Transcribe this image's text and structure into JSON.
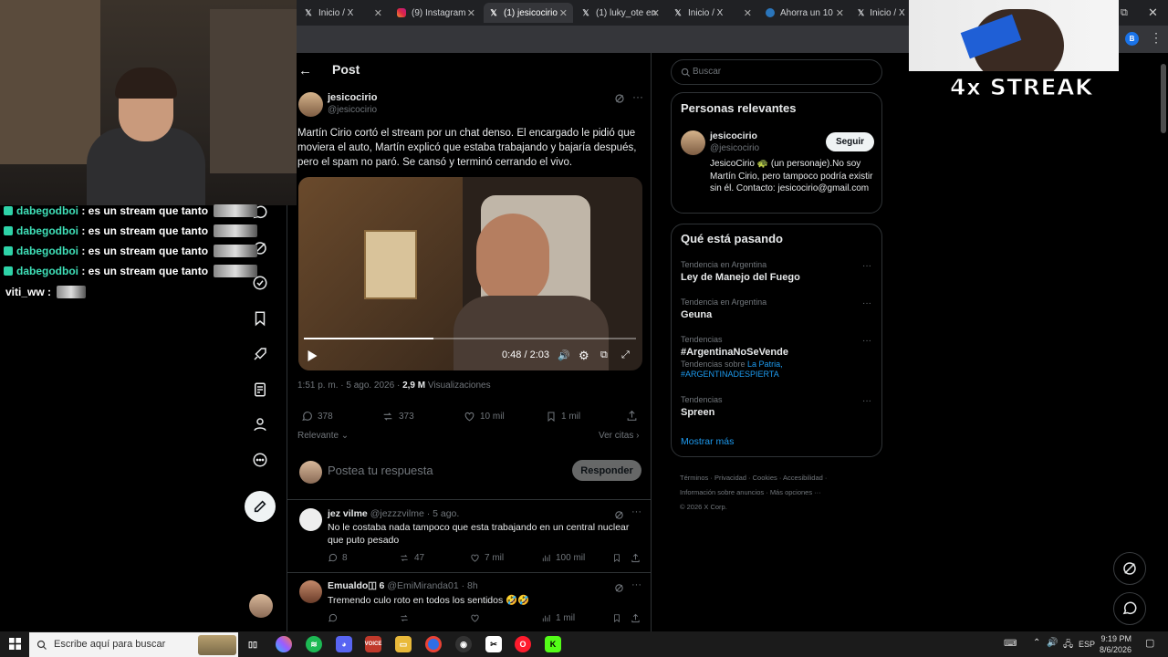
{
  "browser": {
    "tabs": [
      {
        "icon": "x-icon",
        "title": "Inicio / X"
      },
      {
        "icon": "instagram-icon",
        "title": "(9) Instagram"
      },
      {
        "icon": "x-icon",
        "title": "(1) jesicocirio",
        "active": true
      },
      {
        "icon": "x-icon",
        "title": "(1) luky_ote en"
      },
      {
        "icon": "x-icon",
        "title": "Inicio / X"
      },
      {
        "icon": "steam-icon",
        "title": "Ahorra un 10"
      },
      {
        "icon": "x-icon",
        "title": "Inicio / X"
      }
    ]
  },
  "stream_overlay": {
    "streak_text": "4x STREAK",
    "chat": [
      {
        "user": "dabegodboi",
        "message": ": es un stream que tanto"
      },
      {
        "user": "dabegodboi",
        "message": ": es un stream que tanto"
      },
      {
        "user": "dabegodboi",
        "message": ": es un stream que tanto"
      },
      {
        "user": "dabegodboi",
        "message": ": es un stream que tanto"
      },
      {
        "user": "viti_ww",
        "message": ":"
      }
    ]
  },
  "header": {
    "title": "Post"
  },
  "post": {
    "name": "jesicocirio",
    "handle": "@jesicocirio",
    "text": "Martín Cirio cortó el stream por un chat denso. El encargado le pidió que moviera el auto, Martín explicó que estaba trabajando y bajaría después, pero el spam no paró. Se cansó y terminó cerrando el vivo.",
    "video": {
      "time": "0:48 / 2:03",
      "progress": 0.39
    },
    "timestamp": "1:51 p. m. · 5 ago. 2026 · ",
    "views_count": "2,9 M",
    "views_label": "Visualizaciones",
    "actions": {
      "replies": "378",
      "reposts": "373",
      "likes": "10 mil",
      "bookmarks": "1 mil"
    },
    "sort_label": "Relevante",
    "quotes_label": "Ver citas",
    "reply_placeholder": "Postea tu respuesta",
    "reply_button": "Responder"
  },
  "replies": [
    {
      "name": "jez vilme",
      "handle": "@jezzzvilme · 5 ago.",
      "text": "No le costaba nada tampoco que esta trabajando en un central nuclear que puto pesado",
      "actions": {
        "replies": "8",
        "reposts": "47",
        "likes": "7 mil",
        "views": "100 mil"
      }
    },
    {
      "name": "Emualdo🇮 6",
      "handle": "@EmiMiranda01 · 8h",
      "text": "Tremendo culo roto en todos los sentidos 🤣🤣",
      "actions": {
        "replies": "",
        "reposts": "",
        "likes": "",
        "views": "1 mil"
      }
    }
  ],
  "search": {
    "placeholder": "Buscar"
  },
  "relevant": {
    "title": "Personas relevantes",
    "name": "jesicocirio",
    "handle": "@jesicocirio",
    "follow": "Seguir",
    "bio": "JesicoCirio 🐢 (un personaje).No soy Martín Cirio, pero tampoco podría existir sin él. Contacto: jesicocirio@gmail.com"
  },
  "trends": {
    "title": "Qué está pasando",
    "items": [
      {
        "context": "Tendencia en Argentina",
        "name": "Ley de Manejo del Fuego"
      },
      {
        "context": "Tendencia en Argentina",
        "name": "Geuna"
      },
      {
        "context": "Tendencias",
        "name": "#ArgentinaNoSeVende",
        "extra_prefix": "Tendencias sobre ",
        "extra_links": "La Patria, #ARGENTINADESPIERTA"
      },
      {
        "context": "Tendencias",
        "name": "Spreen"
      }
    ],
    "show_more": "Mostrar más"
  },
  "footer": {
    "links1": [
      "Términos",
      "Privacidad",
      "Cookies",
      "Accesibilidad"
    ],
    "links2": [
      "Información sobre anuncios",
      "Más opciones ···"
    ],
    "copyright": "© 2026 X Corp."
  },
  "taskbar": {
    "search_placeholder": "Escribe aquí para buscar",
    "language": "ESP",
    "time": "9:19 PM",
    "date": "8/6/2026"
  },
  "colors": {
    "accent": "#1d9bf0",
    "background": "#000000",
    "border": "#2f3336",
    "muted": "#71767b"
  }
}
